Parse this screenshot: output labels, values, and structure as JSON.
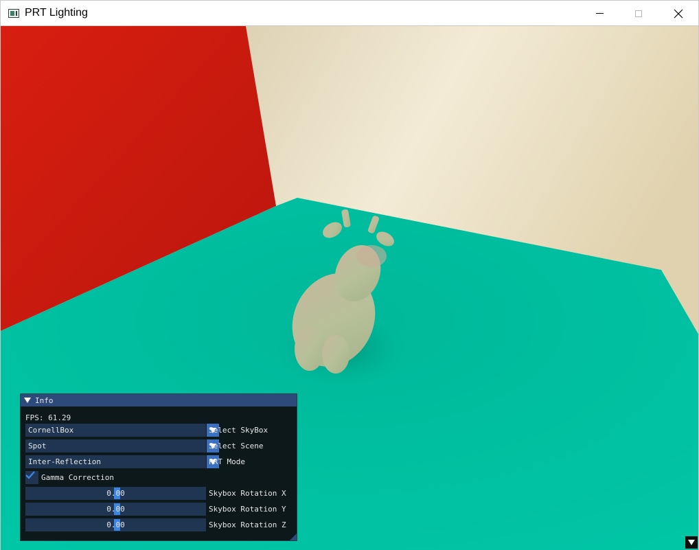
{
  "window": {
    "title": "PRT Lighting",
    "controls": [
      "minimize",
      "maximize",
      "close"
    ]
  },
  "scene": {
    "left_wall_color": "#c8190f",
    "back_wall_color": "#efe3c8",
    "floor_color": "#00c3a4",
    "model": "spot-cow"
  },
  "panel": {
    "title": "Info",
    "fps_text": "FPS: 61.29",
    "skybox": {
      "value": "CornellBox",
      "label": "Select SkyBox"
    },
    "scene_select": {
      "value": "Spot",
      "label": "Select Scene"
    },
    "prt_mode": {
      "value": "Inter-Reflection",
      "label": "PRT Mode"
    },
    "gamma": {
      "checked": true,
      "label": "Gamma Correction"
    },
    "rot_x": {
      "value": "0.00",
      "label": "Skybox Rotation X"
    },
    "rot_y": {
      "value": "0.00",
      "label": "Skybox Rotation Y"
    },
    "rot_z": {
      "value": "0.00",
      "label": "Skybox Rotation Z"
    }
  },
  "colors": {
    "panel_bg": "#0d1114",
    "title_bg": "#2e4a7a",
    "widget_bg": "#1f3552",
    "accent": "#3d84e0"
  }
}
